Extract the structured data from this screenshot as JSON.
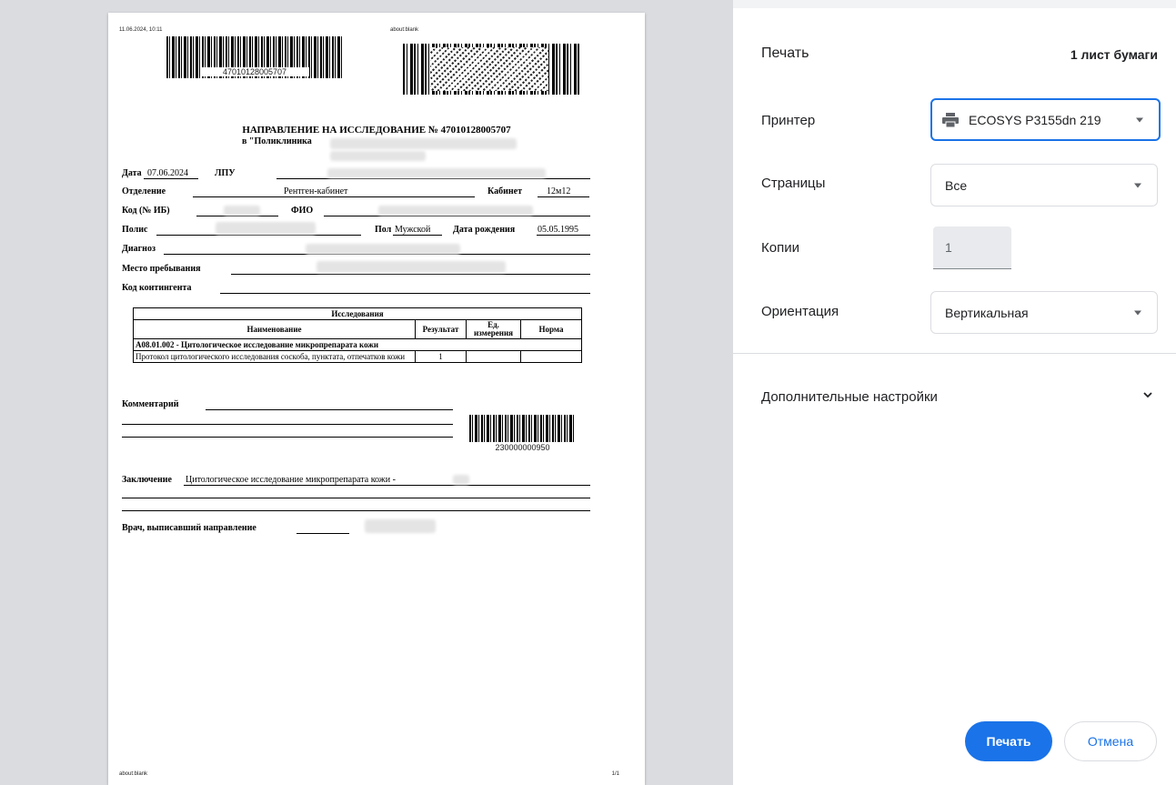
{
  "preview": {
    "header_datetime": "11.06.2024, 10:11",
    "header_url": "about:blank",
    "barcode_top_number": "47010128005707",
    "title": "НАПРАВЛЕНИЕ НА ИССЛЕДОВАНИЕ № 47010128005707",
    "subtitle": "в \"Поликлиника",
    "fields": {
      "date_label": "Дата",
      "date_value": "07.06.2024",
      "lpu_label": "ЛПУ",
      "dept_label": "Отделение",
      "dept_value": "Рентген-кабинет",
      "cabinet_label": "Кабинет",
      "cabinet_value": "12м12",
      "code_label": "Код (№ ИБ)",
      "fio_label": "ФИО",
      "polis_label": "Полис",
      "sex_label": "Пол",
      "sex_value": "Мужской",
      "dob_label": "Дата рождения",
      "dob_value": "05.05.1995",
      "diagnosis_label": "Диагноз",
      "stay_label": "Место пребывания",
      "contingent_label": "Код контингента"
    },
    "table": {
      "caption": "Исследования",
      "headers": [
        "Наименование",
        "Результат",
        "Ед. измерения",
        "Норма"
      ],
      "group": "A08.01.002 - Цитологическое исследование микропрепарата кожи",
      "rows": [
        {
          "name": "Протокол цитологического исследования соскоба, пунктата, отпечатков кожи",
          "result": "1",
          "unit": "",
          "norm": ""
        }
      ]
    },
    "comment_label": "Комментарий",
    "barcode_bottom_number": "230000000950",
    "conclusion_label": "Заключение",
    "conclusion_value": "Цитологическое исследование микропрепарата кожи -",
    "doctor_label": "Врач, выписавший направление",
    "footer_url": "about:blank",
    "footer_page": "1/1"
  },
  "panel": {
    "title": "Печать",
    "sheets": "1 лист бумаги",
    "printer_label": "Принтер",
    "printer_value": "ECOSYS P3155dn 219",
    "pages_label": "Страницы",
    "pages_value": "Все",
    "copies_label": "Копии",
    "copies_value": "1",
    "orientation_label": "Ориентация",
    "orientation_value": "Вертикальная",
    "more_settings": "Дополнительные настройки",
    "print_button": "Печать",
    "cancel_button": "Отмена"
  },
  "colors": {
    "accent": "#1a73e8",
    "preview_bg": "#dadce0",
    "text": "#202124"
  },
  "icons": [
    "printer-icon",
    "dropdown-arrow-icon",
    "chevron-down-icon"
  ]
}
